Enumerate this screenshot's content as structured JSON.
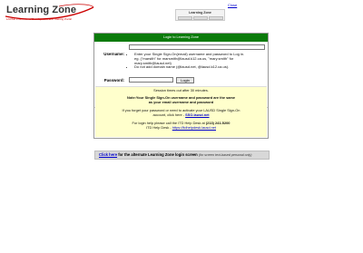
{
  "logo": {
    "title": "Learning Zone",
    "subtitle": "LAUSD Professional Development and Training Portal"
  },
  "mini_window": {
    "title": "Learning Zone",
    "tabs": [
      "",
      "",
      ""
    ]
  },
  "close_link": "Close",
  "panel": {
    "header": "Login to Learning Zone",
    "username_label": "Username:",
    "username_value": "",
    "instructions": {
      "line1": "Enter your Single Sign-On(email) username and password to Log in.",
      "line2": "eg. (\"marsith\" for marsmith@lausd.k12.ca.us, \"mary.smith\" for mary.smith@lausd.net)",
      "line3": "Do not add domain name (@lausd.net, @lausd.k12.ca.us)."
    },
    "password_label": "Password:",
    "password_value": "",
    "login_button": "Login"
  },
  "notice": {
    "timeout": "Session times out after 30 minutes.",
    "note_line1": "Note:Your Single Sign-On username and password are the same",
    "note_line2": "as your email username and password",
    "forgot_line1": "If you forget your password or need to activate your LAUSD Single Sign-On",
    "forgot_line2": "account, click here -",
    "forgot_link": "SSO.lausd.net",
    "help_line": "For login help please call the ITD Help Desk at",
    "help_phone": "(213) 241-5200",
    "helpdesk_prefix": "ITD Help Desk -",
    "helpdesk_link": "https://itdhelpdesk.lausd.net"
  },
  "alt_bar": {
    "link": "Click here",
    "text": "for the alternate Learning Zone login screen",
    "note": "(for screen text-based personal only)"
  }
}
